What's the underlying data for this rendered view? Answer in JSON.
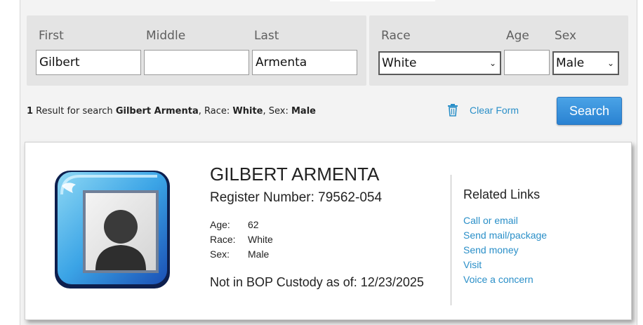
{
  "search_form": {
    "first_label": "First",
    "middle_label": "Middle",
    "last_label": "Last",
    "first_value": "Gilbert",
    "middle_value": "",
    "last_value": "Armenta",
    "race_label": "Race",
    "age_label": "Age",
    "sex_label": "Sex",
    "race_value": "White",
    "age_value": "",
    "sex_value": "Male"
  },
  "results_summary": {
    "count": "1",
    "text1": " Result for search ",
    "query": "Gilbert Armenta",
    "race_prefix": ", Race: ",
    "race": "White",
    "sex_prefix": ", Sex: ",
    "sex": "Male"
  },
  "actions": {
    "clear_label": "Clear Form",
    "search_label": "Search"
  },
  "inmate": {
    "name": "GILBERT ARMENTA",
    "register": "Register Number: 79562-054",
    "age_label": "Age:",
    "age": "62",
    "race_label": "Race:",
    "race": "White",
    "sex_label": "Sex:",
    "sex": "Male",
    "custody": "Not in BOP Custody as of: 12/23/2025"
  },
  "related": {
    "title": "Related Links",
    "links": [
      "Call or email",
      "Send mail/package",
      "Send money",
      "Visit",
      "Voice a concern"
    ]
  },
  "colors": {
    "link": "#2a8fc8",
    "button": "#2a82d2"
  },
  "icons": {
    "clear": "trash-icon",
    "dropdown": "chevron-down-icon",
    "avatar": "person-silhouette-icon"
  }
}
